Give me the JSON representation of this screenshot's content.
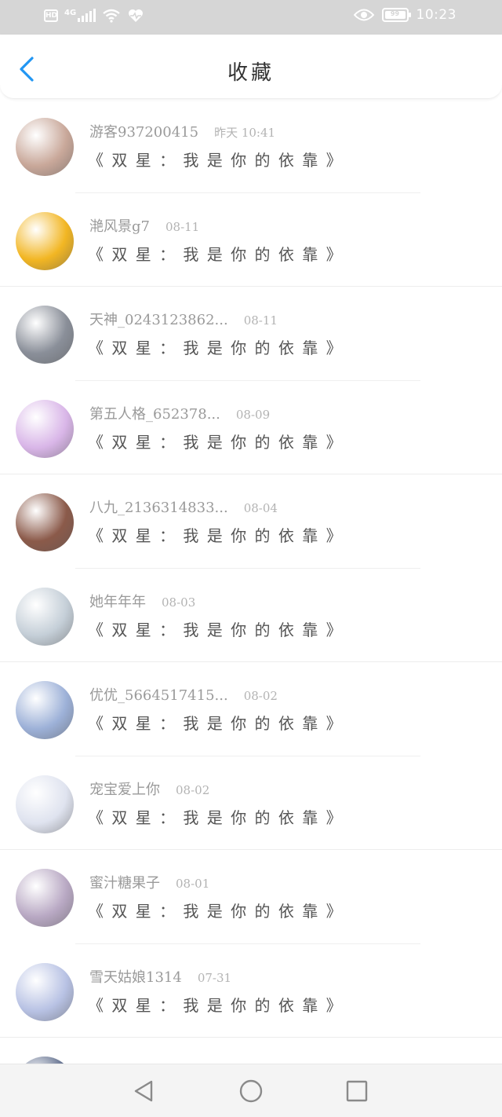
{
  "status_bar": {
    "hd_badge": "HD",
    "network": "4G",
    "time": "10:23",
    "battery_text": "99",
    "battery_level": 0.99
  },
  "header": {
    "title": "收藏",
    "back_icon": "chevron-left-icon",
    "accent_color": "#2196f3"
  },
  "favorites": [
    {
      "user": "游客937200415",
      "date": "昨天 10:41",
      "title": "《 双 星 ： 我 是 你 的 依 靠 》",
      "avatar_color": "#c9a89a"
    },
    {
      "user": "滟风景g7",
      "date": "08-11",
      "title": "《 双 星 ： 我 是 你 的 依 靠 》",
      "avatar_color": "#f2b623"
    },
    {
      "user": "天神_0243123862...",
      "date": "08-11",
      "title": "《 双 星 ： 我 是 你 的 依 靠 》",
      "avatar_color": "#8a8f99"
    },
    {
      "user": "第五人格_652378...",
      "date": "08-09",
      "title": "《 双 星 ： 我 是 你 的 依 靠 》",
      "avatar_color": "#d9b6e8"
    },
    {
      "user": "八九_2136314833...",
      "date": "08-04",
      "title": "《 双 星 ： 我 是 你 的 依 靠 》",
      "avatar_color": "#8b5a4a"
    },
    {
      "user": "她年年年",
      "date": "08-03",
      "title": "《 双 星 ： 我 是 你 的 依 靠 》",
      "avatar_color": "#c5cfd8"
    },
    {
      "user": "优优_5664517415...",
      "date": "08-02",
      "title": "《 双 星 ： 我 是 你 的 依 靠 》",
      "avatar_color": "#9db1d8"
    },
    {
      "user": "宠宝爱上你",
      "date": "08-02",
      "title": "《 双 星 ： 我 是 你 的 依 靠 》",
      "avatar_color": "#dfe3ef"
    },
    {
      "user": "蜜汁糖果子",
      "date": "08-01",
      "title": "《 双 星 ： 我 是 你 的 依 靠 》",
      "avatar_color": "#b9a9c4"
    },
    {
      "user": "雪天姑娘1314",
      "date": "07-31",
      "title": "《 双 星 ： 我 是 你 的 依 靠 》",
      "avatar_color": "#b8c2e4"
    },
    {
      "user": "",
      "date": "",
      "title": "",
      "avatar_color": "#5c6a8a"
    }
  ],
  "nav": {
    "back_icon": "triangle-back-icon",
    "home_icon": "circle-home-icon",
    "recents_icon": "square-recents-icon"
  }
}
